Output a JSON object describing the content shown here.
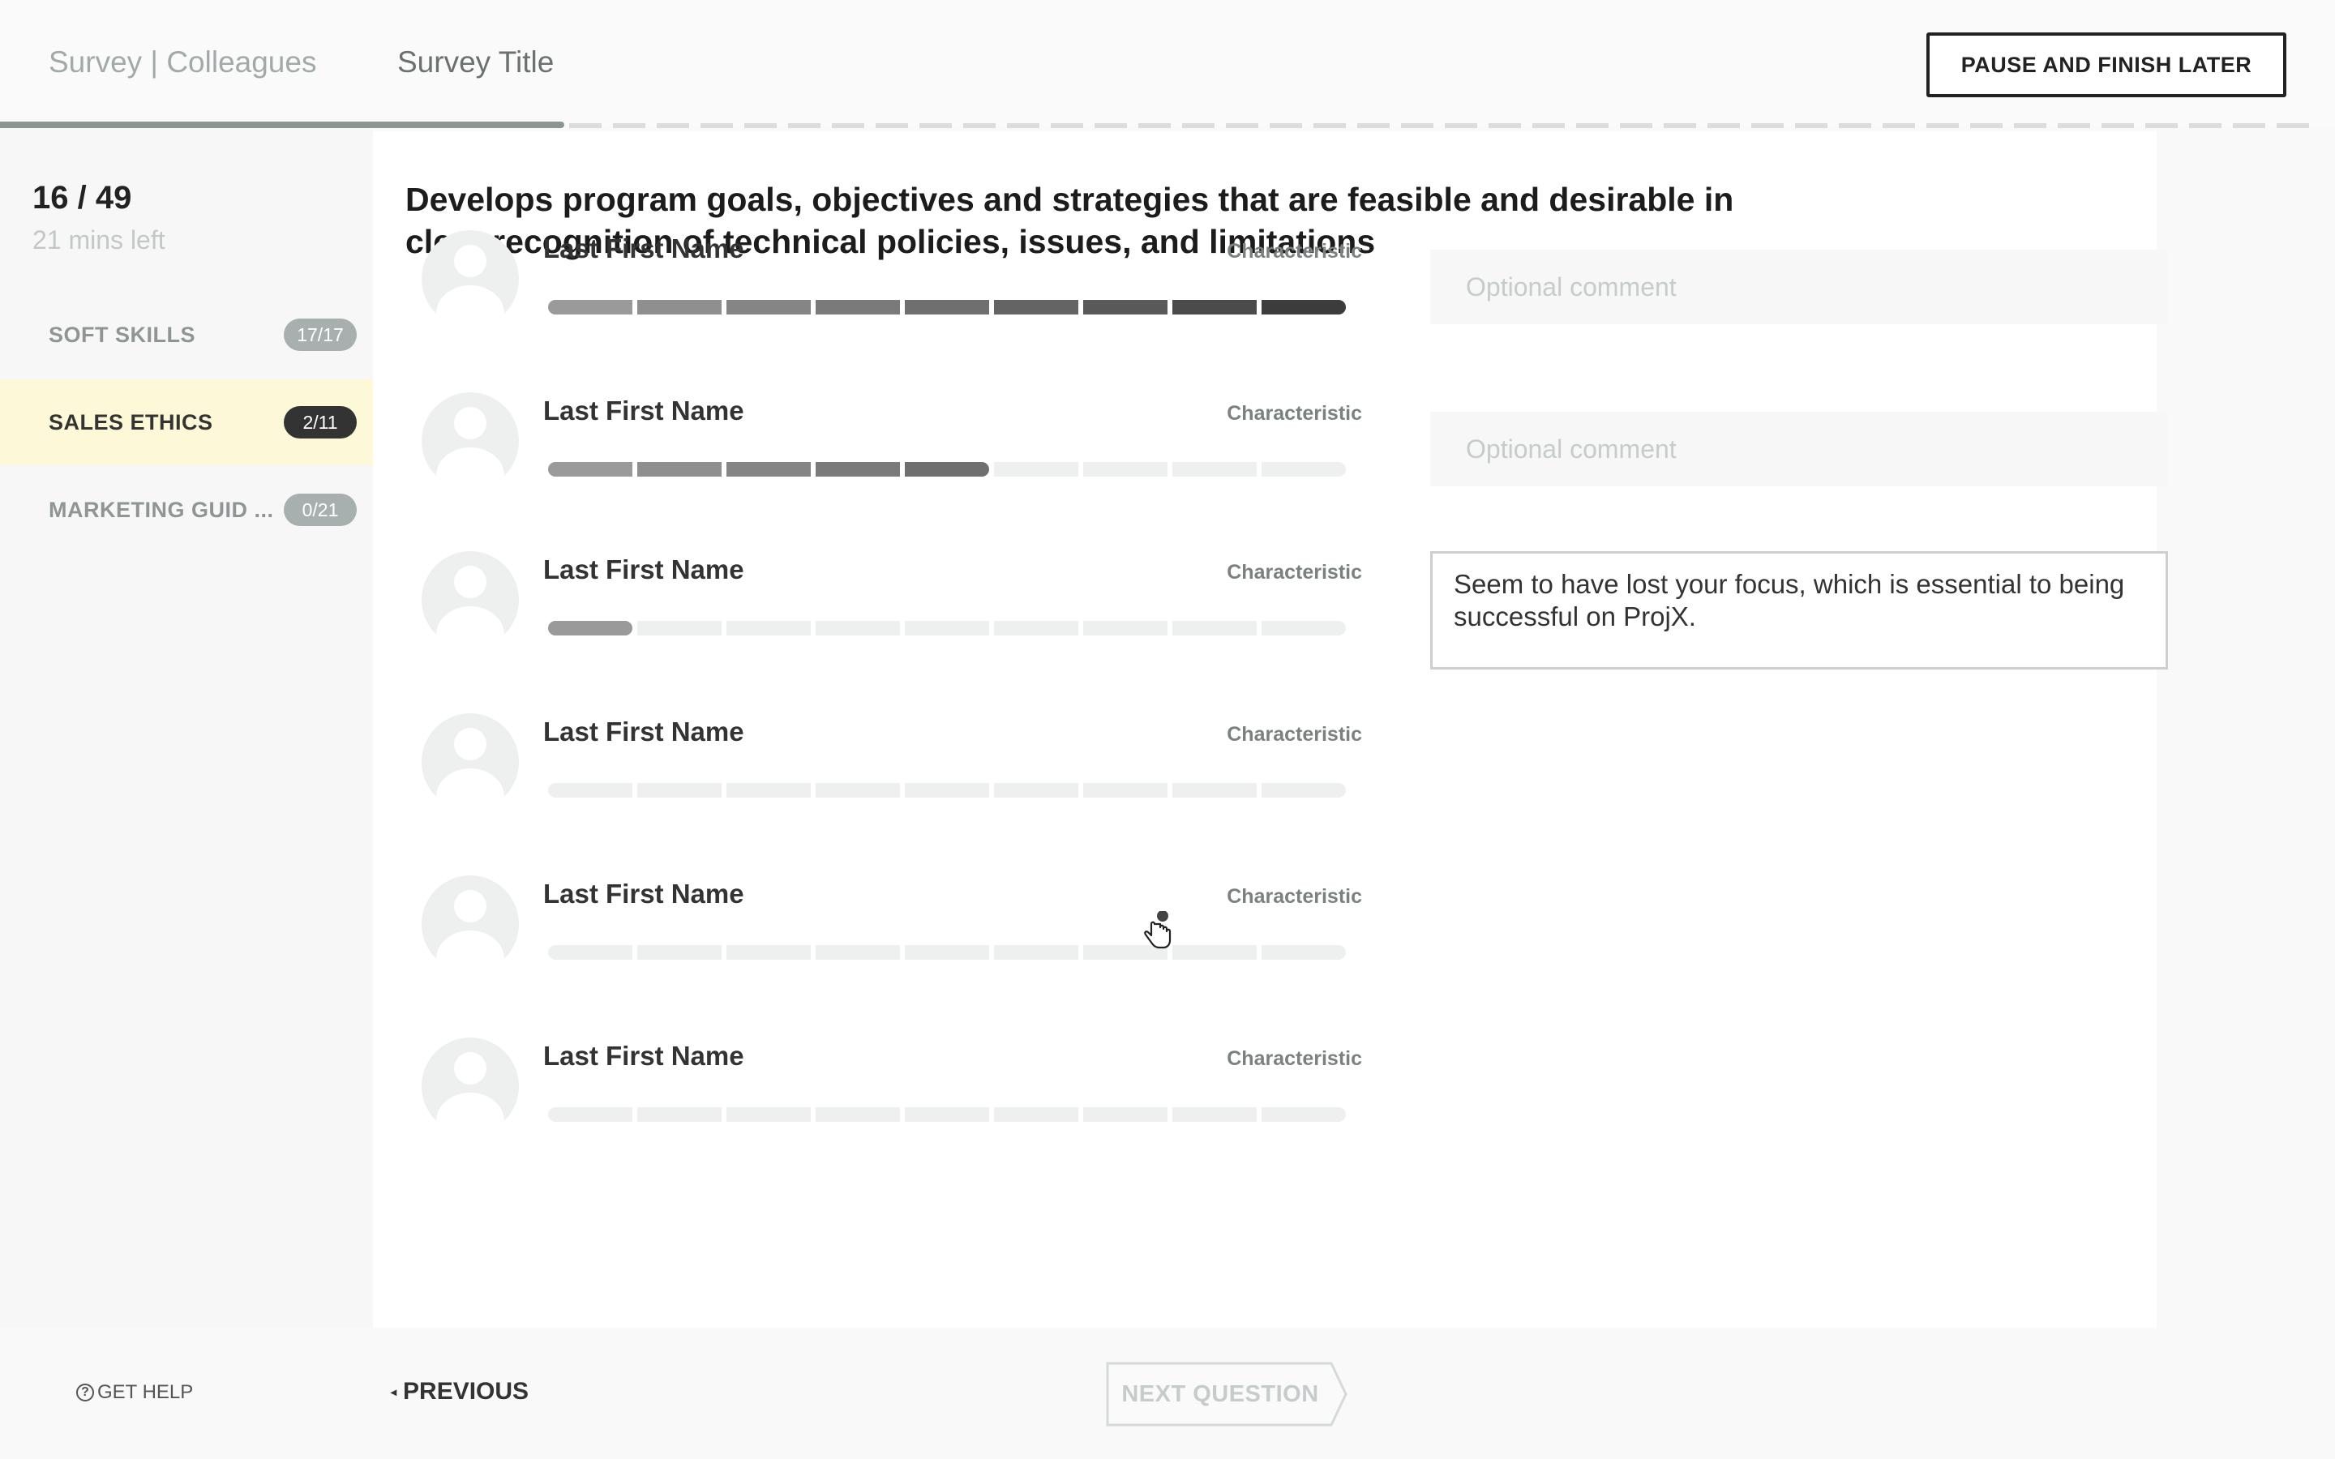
{
  "header": {
    "brand": "Survey | Colleagues",
    "survey_title": "Survey Title",
    "pause_label": "PAUSE AND FINISH LATER"
  },
  "progress": {
    "fraction": 0.3265
  },
  "sidebar": {
    "counter": "16 / 49",
    "time_left": "21 mins left",
    "sections": [
      {
        "label": "SOFT SKILLS",
        "badge": "17/17",
        "active": false
      },
      {
        "label": "SALES ETHICS",
        "badge": "2/11",
        "active": true
      },
      {
        "label": "MARKETING GUID ...",
        "badge": "0/21",
        "active": false
      }
    ]
  },
  "question": {
    "text": "Develops program goals, objectives and strategies that are feasible and desirable in clear recognition of technical policies, issues, and limitations"
  },
  "rating_scale_max": 9,
  "colors": {
    "scale_steps": [
      "#9a9a9a",
      "#8f8f8f",
      "#858585",
      "#7a7a7a",
      "#6f6f6f",
      "#646464",
      "#595959",
      "#4b4b4b",
      "#3c3c3c"
    ],
    "empty_segment": "#eef0f0",
    "active_section": "#fdf8d7"
  },
  "ratings": [
    {
      "name": "Last First Name",
      "characteristic": "Characteristic",
      "rating": 9,
      "comment": "",
      "comment_placeholder": "Optional comment"
    },
    {
      "name": "Last First Name",
      "characteristic": "Characteristic",
      "rating": 5,
      "comment": "",
      "comment_placeholder": "Optional comment"
    },
    {
      "name": "Last First Name",
      "characteristic": "Characteristic",
      "rating": 1,
      "comment": "Seem to have lost your focus, which is essential to being successful on ProjX.",
      "comment_placeholder": ""
    },
    {
      "name": "Last First Name",
      "characteristic": "Characteristic",
      "rating": 0,
      "comment": null,
      "comment_placeholder": null
    },
    {
      "name": "Last First Name",
      "characteristic": "Characteristic",
      "rating": 0,
      "comment": null,
      "comment_placeholder": null
    },
    {
      "name": "Last First Name",
      "characteristic": "Characteristic",
      "rating": 0,
      "comment": null,
      "comment_placeholder": null
    }
  ],
  "footer": {
    "help_label": "GET HELP",
    "previous_label": "PREVIOUS",
    "next_label": "NEXT QUESTION"
  },
  "icons": {
    "help": "question-circle-icon",
    "previous": "chevron-left-icon",
    "cursor": "hand-pointer-cursor-icon"
  }
}
